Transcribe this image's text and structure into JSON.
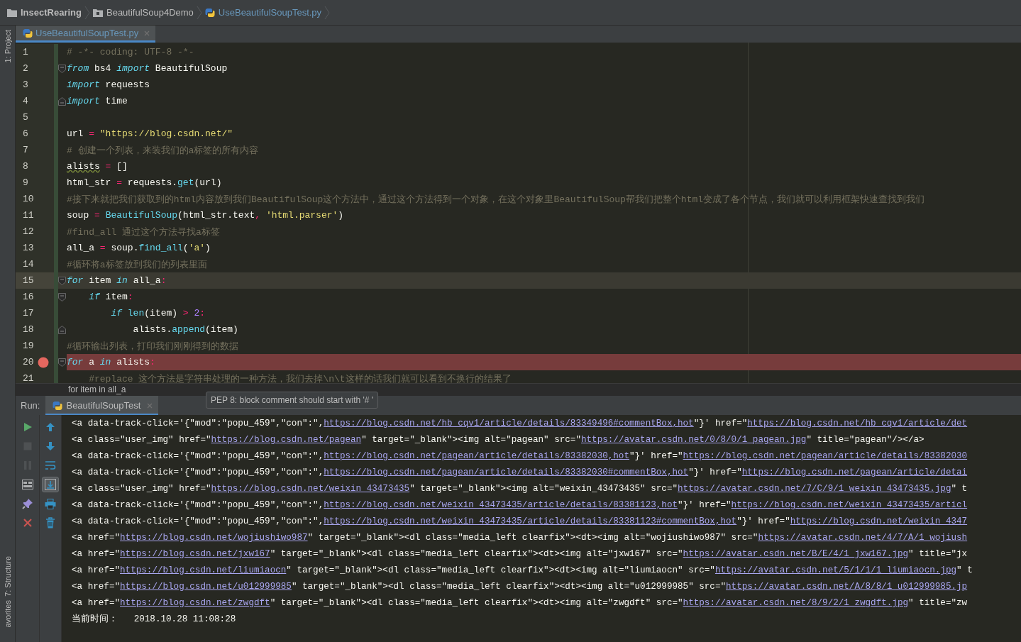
{
  "breadcrumbs": [
    {
      "label": "InsectRearing",
      "kind": "project"
    },
    {
      "label": "BeautifulSoup4Demo",
      "kind": "folder"
    },
    {
      "label": "UseBeautifulSoupTest.py",
      "kind": "file"
    }
  ],
  "side_labels": {
    "top": "1: Project",
    "middle": "7: Structure",
    "bottom": "avorites"
  },
  "editor": {
    "tab": {
      "label": "UseBeautifulSoupTest.py",
      "selected": true
    },
    "lines": [
      {
        "no": "1",
        "fold_start": false,
        "fold_end": false,
        "current": false,
        "breakpoint": false,
        "tokens": [
          {
            "kind": "comment",
            "text": "# -*- coding: UTF-8 -*-"
          }
        ]
      },
      {
        "no": "2",
        "fold_start": true,
        "fold_end": false,
        "current": false,
        "breakpoint": false,
        "tokens": [
          {
            "kind": "kw",
            "text": "from"
          },
          {
            "kind": "text",
            "text": " bs4 "
          },
          {
            "kind": "kw",
            "text": "import"
          },
          {
            "kind": "text",
            "text": " BeautifulSoup"
          }
        ]
      },
      {
        "no": "3",
        "fold_start": false,
        "fold_end": false,
        "current": false,
        "breakpoint": false,
        "tokens": [
          {
            "kind": "kw",
            "text": "import"
          },
          {
            "kind": "text",
            "text": " requests"
          }
        ]
      },
      {
        "no": "4",
        "fold_start": false,
        "fold_end": true,
        "current": false,
        "breakpoint": false,
        "tokens": [
          {
            "kind": "kw",
            "text": "import"
          },
          {
            "kind": "text",
            "text": " time"
          }
        ]
      },
      {
        "no": "5",
        "fold_start": false,
        "fold_end": false,
        "current": false,
        "breakpoint": false
      },
      {
        "no": "6",
        "fold_start": false,
        "fold_end": false,
        "current": false,
        "breakpoint": false,
        "tokens": [
          {
            "kind": "text",
            "text": "url"
          },
          {
            "kind": "op",
            "text": " = "
          },
          {
            "kind": "str",
            "text": "\"https://blog.csdn.net/\""
          }
        ]
      },
      {
        "no": "7",
        "fold_start": false,
        "fold_end": false,
        "current": false,
        "breakpoint": false,
        "tokens": [
          {
            "kind": "comment",
            "text": "# 创建一个列表，来装我们的a标签的所有内容"
          }
        ]
      },
      {
        "no": "8",
        "fold_start": false,
        "fold_end": false,
        "current": false,
        "breakpoint": false,
        "tokens": [
          {
            "kind": "warn",
            "text": "alists"
          },
          {
            "kind": "op",
            "text": " = "
          },
          {
            "kind": "text",
            "text": "[]"
          }
        ]
      },
      {
        "no": "9",
        "fold_start": false,
        "fold_end": false,
        "current": false,
        "breakpoint": false,
        "tokens": [
          {
            "kind": "text",
            "text": "html_str"
          },
          {
            "kind": "op",
            "text": " = "
          },
          {
            "kind": "text",
            "text": "requests."
          },
          {
            "kind": "call",
            "text": "get"
          },
          {
            "kind": "text",
            "text": "(url)"
          }
        ]
      },
      {
        "no": "10",
        "fold_start": false,
        "fold_end": false,
        "current": false,
        "breakpoint": false,
        "tokens": [
          {
            "kind": "comment",
            "text": "#接下来就把我们获取到的html内容放到我们BeautifulSoup这个方法中，通过这个方法得到一个对象，在这个对象里BeautifulSoup帮我们把整个html变成了各个节点，我们就可以利用框架快速查找到我们"
          }
        ]
      },
      {
        "no": "11",
        "fold_start": false,
        "fold_end": false,
        "current": false,
        "breakpoint": false,
        "tokens": [
          {
            "kind": "text",
            "text": "soup"
          },
          {
            "kind": "op",
            "text": " = "
          },
          {
            "kind": "call",
            "text": "BeautifulSoup"
          },
          {
            "kind": "text",
            "text": "(html_str.text"
          },
          {
            "kind": "op",
            "text": ", "
          },
          {
            "kind": "str",
            "text": "'html.parser'"
          },
          {
            "kind": "text",
            "text": ")"
          }
        ]
      },
      {
        "no": "12",
        "fold_start": false,
        "fold_end": false,
        "current": false,
        "breakpoint": false,
        "tokens": [
          {
            "kind": "comment",
            "text": "#find_all 通过这个方法寻找a标签"
          }
        ]
      },
      {
        "no": "13",
        "fold_start": false,
        "fold_end": false,
        "current": false,
        "breakpoint": false,
        "tokens": [
          {
            "kind": "text",
            "text": "all_a"
          },
          {
            "kind": "op",
            "text": " = "
          },
          {
            "kind": "text",
            "text": "soup."
          },
          {
            "kind": "call",
            "text": "find_all"
          },
          {
            "kind": "text",
            "text": "("
          },
          {
            "kind": "str",
            "text": "'a'"
          },
          {
            "kind": "text",
            "text": ")"
          }
        ]
      },
      {
        "no": "14",
        "fold_start": false,
        "fold_end": false,
        "current": false,
        "breakpoint": false,
        "tokens": [
          {
            "kind": "comment",
            "text": "#循环将a标签放到我们的列表里面"
          }
        ]
      },
      {
        "no": "15",
        "fold_start": true,
        "fold_end": false,
        "current": true,
        "breakpoint": false,
        "tokens": [
          {
            "kind": "kw",
            "text": "for"
          },
          {
            "kind": "text",
            "text": " item "
          },
          {
            "kind": "kw",
            "text": "in"
          },
          {
            "kind": "text",
            "text": " all_a"
          },
          {
            "kind": "op",
            "text": ":"
          }
        ]
      },
      {
        "no": "16",
        "fold_start": true,
        "fold_end": false,
        "current": false,
        "breakpoint": false,
        "tokens": [
          {
            "kind": "kw",
            "text": "    if"
          },
          {
            "kind": "text",
            "text": " item"
          },
          {
            "kind": "op",
            "text": ":"
          }
        ]
      },
      {
        "no": "17",
        "fold_start": false,
        "fold_end": false,
        "current": false,
        "breakpoint": false,
        "tokens": [
          {
            "kind": "kw",
            "text": "        if"
          },
          {
            "kind": "call",
            "text": " len"
          },
          {
            "kind": "text",
            "text": "(item)"
          },
          {
            "kind": "op",
            "text": " > "
          },
          {
            "kind": "num",
            "text": "2"
          },
          {
            "kind": "op",
            "text": ":"
          }
        ]
      },
      {
        "no": "18",
        "fold_start": false,
        "fold_end": true,
        "current": false,
        "breakpoint": false,
        "tokens": [
          {
            "kind": "text",
            "text": "            alists."
          },
          {
            "kind": "call",
            "text": "append"
          },
          {
            "kind": "text",
            "text": "(item)"
          }
        ]
      },
      {
        "no": "19",
        "fold_start": false,
        "fold_end": false,
        "current": false,
        "breakpoint": false,
        "tokens": [
          {
            "kind": "comment",
            "text": "#循环输出列表，打印我们刚刚得到的数据"
          }
        ]
      },
      {
        "no": "20",
        "fold_start": true,
        "fold_end": false,
        "current": false,
        "breakpoint": true,
        "tokens": [
          {
            "kind": "kw",
            "text": "for"
          },
          {
            "kind": "text",
            "text": " a "
          },
          {
            "kind": "kw",
            "text": "in"
          },
          {
            "kind": "text",
            "text": " alists"
          },
          {
            "kind": "op",
            "text": ":"
          }
        ]
      },
      {
        "no": "21",
        "fold_start": false,
        "fold_end": false,
        "current": false,
        "breakpoint": false,
        "tokens": [
          {
            "kind": "comment",
            "text": "    #replace 这个方法是字符串处理的一种方法，我们去掉\\n\\t这样的话我们就可以看到不换行的结果了"
          }
        ]
      }
    ],
    "breadcrumb": "for item in all_a"
  },
  "tooltip": "PEP 8: block comment should start with '# '",
  "run": {
    "label": "Run:",
    "tab": {
      "label": "BeautifulSoupTest",
      "selected": true
    },
    "tools_left": [
      {
        "kind": "run",
        "disabled": false
      },
      {
        "kind": "stop",
        "disabled": true
      },
      {
        "kind": "pause",
        "disabled": true
      },
      {
        "kind": "dump",
        "disabled": false
      },
      {
        "kind": "pin",
        "disabled": false
      },
      {
        "kind": "close",
        "disabled": false
      }
    ],
    "tools_right": [
      {
        "kind": "up",
        "selected": false
      },
      {
        "kind": "down",
        "selected": false
      },
      {
        "kind": "wrap",
        "selected": false
      },
      {
        "kind": "scroll",
        "selected": true
      },
      {
        "kind": "print",
        "selected": false
      },
      {
        "kind": "trash",
        "selected": false
      }
    ],
    "output": [
      [
        {
          "text": "<a data-track-click='{\"mod\":\"popu_459\",\"con\":\",",
          "link": false
        },
        {
          "text": "https://blog.csdn.net/hb_cqv1/article/details/83349496#commentBox,hot",
          "link": true
        },
        {
          "text": "\"}' href=\"",
          "link": false
        },
        {
          "text": "https://blog.csdn.net/hb_cqv1/article/det",
          "link": true
        }
      ],
      [
        {
          "text": "<a class=\"user_img\" href=\"",
          "link": false
        },
        {
          "text": "https://blog.csdn.net/pagean",
          "link": true
        },
        {
          "text": "\" target=\"_blank\"><img alt=\"pagean\" src=\"",
          "link": false
        },
        {
          "text": "https://avatar.csdn.net/0/8/0/1_pagean.jpg",
          "link": true
        },
        {
          "text": "\" title=\"pagean\"/></a>",
          "link": false
        }
      ],
      [
        {
          "text": "<a data-track-click='{\"mod\":\"popu_459\",\"con\":\",",
          "link": false
        },
        {
          "text": "https://blog.csdn.net/pagean/article/details/83382030,hot",
          "link": true
        },
        {
          "text": "\"}' href=\"",
          "link": false
        },
        {
          "text": "https://blog.csdn.net/pagean/article/details/83382030",
          "link": true
        }
      ],
      [
        {
          "text": "<a data-track-click='{\"mod\":\"popu_459\",\"con\":\",",
          "link": false
        },
        {
          "text": "https://blog.csdn.net/pagean/article/details/83382030#commentBox,hot",
          "link": true
        },
        {
          "text": "\"}' href=\"",
          "link": false
        },
        {
          "text": "https://blog.csdn.net/pagean/article/detai",
          "link": true
        }
      ],
      [
        {
          "text": "<a class=\"user_img\" href=\"",
          "link": false
        },
        {
          "text": "https://blog.csdn.net/weixin_43473435",
          "link": true
        },
        {
          "text": "\" target=\"_blank\"><img alt=\"weixin_43473435\" src=\"",
          "link": false
        },
        {
          "text": "https://avatar.csdn.net/7/C/9/1_weixin_43473435.jpg",
          "link": true
        },
        {
          "text": "\" t",
          "link": false
        }
      ],
      [
        {
          "text": "<a data-track-click='{\"mod\":\"popu_459\",\"con\":\",",
          "link": false
        },
        {
          "text": "https://blog.csdn.net/weixin_43473435/article/details/83381123,hot",
          "link": true
        },
        {
          "text": "\"}' href=\"",
          "link": false
        },
        {
          "text": "https://blog.csdn.net/weixin_43473435/articl",
          "link": true
        }
      ],
      [
        {
          "text": "<a data-track-click='{\"mod\":\"popu_459\",\"con\":\",",
          "link": false
        },
        {
          "text": "https://blog.csdn.net/weixin_43473435/article/details/83381123#commentBox,hot",
          "link": true
        },
        {
          "text": "\"}' href=\"",
          "link": false
        },
        {
          "text": "https://blog.csdn.net/weixin_4347",
          "link": true
        }
      ],
      [
        {
          "text": "<a href=\"",
          "link": false
        },
        {
          "text": "https://blog.csdn.net/wojiushiwo987",
          "link": true
        },
        {
          "text": "\" target=\"_blank\"><dl class=\"media_left clearfix\"><dt><img alt=\"wojiushiwo987\" src=\"",
          "link": false
        },
        {
          "text": "https://avatar.csdn.net/4/7/A/1_wojiush",
          "link": true
        }
      ],
      [
        {
          "text": "<a href=\"",
          "link": false
        },
        {
          "text": "https://blog.csdn.net/jxw167",
          "link": true
        },
        {
          "text": "\" target=\"_blank\"><dl class=\"media_left clearfix\"><dt><img alt=\"jxw167\" src=\"",
          "link": false
        },
        {
          "text": "https://avatar.csdn.net/B/E/4/1_jxw167.jpg",
          "link": true
        },
        {
          "text": "\" title=\"jx",
          "link": false
        }
      ],
      [
        {
          "text": "<a href=\"",
          "link": false
        },
        {
          "text": "https://blog.csdn.net/liumiaocn",
          "link": true
        },
        {
          "text": "\" target=\"_blank\"><dl class=\"media_left clearfix\"><dt><img alt=\"liumiaocn\" src=\"",
          "link": false
        },
        {
          "text": "https://avatar.csdn.net/5/1/1/1_liumiaocn.jpg",
          "link": true
        },
        {
          "text": "\" t",
          "link": false
        }
      ],
      [
        {
          "text": "<a href=\"",
          "link": false
        },
        {
          "text": "https://blog.csdn.net/u012999985",
          "link": true
        },
        {
          "text": "\" target=\"_blank\"><dl class=\"media_left clearfix\"><dt><img alt=\"u012999985\" src=\"",
          "link": false
        },
        {
          "text": "https://avatar.csdn.net/A/8/8/1_u012999985.jp",
          "link": true
        }
      ],
      [
        {
          "text": "<a href=\"",
          "link": false
        },
        {
          "text": "https://blog.csdn.net/zwgdft",
          "link": true
        },
        {
          "text": "\" target=\"_blank\"><dl class=\"media_left clearfix\"><dt><img alt=\"zwgdft\" src=\"",
          "link": false
        },
        {
          "text": "https://avatar.csdn.net/8/9/2/1_zwgdft.jpg",
          "link": true
        },
        {
          "text": "\" title=\"zw",
          "link": false
        }
      ],
      [
        {
          "text": "当前时间：   2018.10.28 11:08:28",
          "link": false
        }
      ]
    ]
  }
}
